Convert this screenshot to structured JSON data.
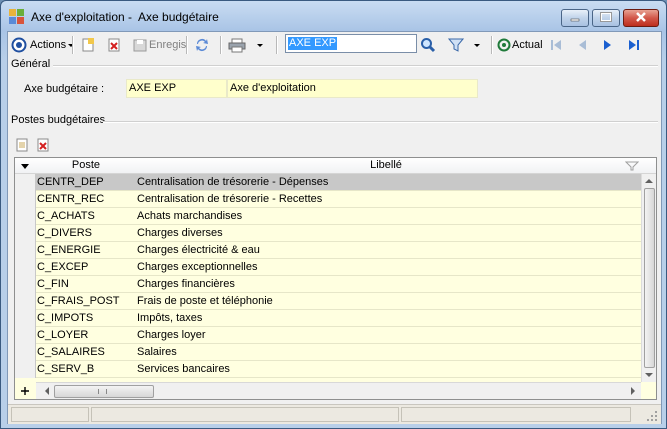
{
  "window": {
    "title": "Axe d'exploitation -  Axe budgétaire"
  },
  "toolbar": {
    "actions_label": "Actions",
    "save_label": "Enregis",
    "search_value": "AXE EXP",
    "actual_label": "Actual"
  },
  "general": {
    "section_title": "Général",
    "axe_label": "Axe budgétaire :",
    "axe_code": "AXE EXP",
    "axe_name": "Axe d'exploitation"
  },
  "postes": {
    "section_title": "Postes budgétaires",
    "columns": [
      "Poste",
      "Libellé"
    ],
    "rows": [
      [
        "CENTR_DEP",
        "Centralisation de trésorerie - Dépenses"
      ],
      [
        "CENTR_REC",
        "Centralisation de trésorerie - Recettes"
      ],
      [
        "C_ACHATS",
        "Achats marchandises"
      ],
      [
        "C_DIVERS",
        "Charges diverses"
      ],
      [
        "C_ENERGIE",
        "Charges électricité & eau"
      ],
      [
        "C_EXCEP",
        "Charges exceptionnelles"
      ],
      [
        "C_FIN",
        "Charges financières"
      ],
      [
        "C_FRAIS_POST",
        "Frais de poste et téléphonie"
      ],
      [
        "C_IMPOTS",
        "Impôts, taxes"
      ],
      [
        "C_LOYER",
        "Charges loyer"
      ],
      [
        "C_SALAIRES",
        "Salaires"
      ],
      [
        "C_SERV_B",
        "Services bancaires"
      ]
    ],
    "selected_row": 0
  },
  "colors": {
    "field_bg": "#ffffcc",
    "grid_bg": "#ffffe0",
    "selected_row": "#c8c8c8",
    "accent": "#3399ff"
  }
}
